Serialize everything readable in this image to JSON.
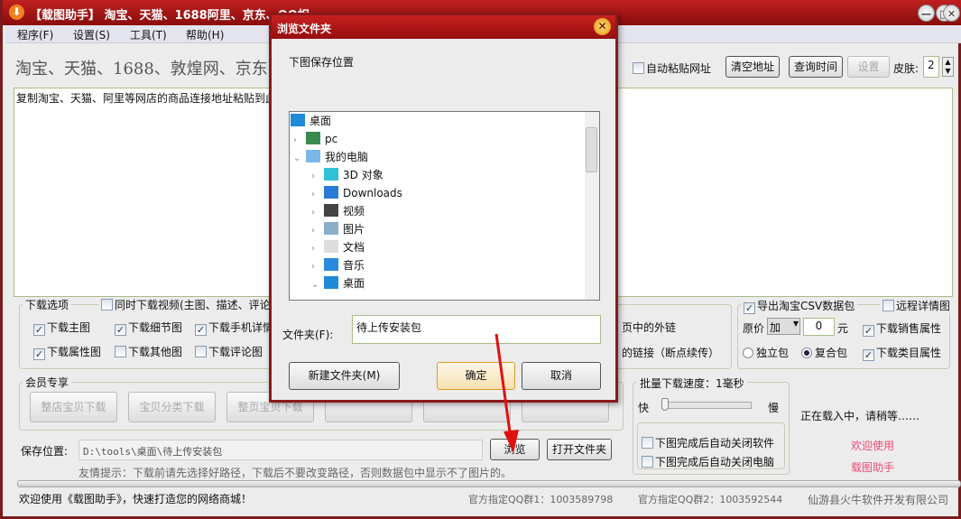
{
  "window": {
    "title": "【载图助手】 淘宝、天猫、1688阿里、京东、QQ相",
    "minimize": "—",
    "maximize": "□",
    "close": "✕"
  },
  "menu": [
    "程序(F)",
    "设置(S)",
    "工具(T)",
    "帮助(H)"
  ],
  "heading": "淘宝、天猫、1688、敦煌网、京东",
  "toolbar": {
    "auto_paste": "自动粘贴网址",
    "clear": "清空地址",
    "query_time": "查询时间",
    "settings": "设置",
    "skin_label": "皮肤:",
    "skin_value": "2"
  },
  "textarea": {
    "placeholder": "复制淘宝、天猫、阿里等网店的商品连接地址粘贴到此"
  },
  "options": {
    "title": "下载选项",
    "video": {
      "label": "同时下载视频(主图、描述、评论",
      "checked": false
    },
    "items": [
      {
        "label": "下载主图",
        "checked": true
      },
      {
        "label": "下载细节图",
        "checked": true
      },
      {
        "label": "下载手机详情",
        "checked": true
      },
      {
        "label": "下载属性图",
        "checked": true
      },
      {
        "label": "下载其他图",
        "checked": false
      },
      {
        "label": "下载评论图",
        "checked": false
      }
    ],
    "ext_link": "页中的外链",
    "resume_link": "的链接（断点续传）"
  },
  "csv": {
    "export": {
      "label": "导出淘宝CSV数据包",
      "checked": true
    },
    "remote": {
      "label": "远程详情图",
      "checked": false
    },
    "price_label": "原价",
    "price_op": "加",
    "price_value": "0",
    "price_unit": "元",
    "sales_attr": {
      "label": "下载销售属性",
      "checked": true
    },
    "category_attr": {
      "label": "下载类目属性",
      "checked": true
    },
    "standalone": "独立包",
    "composite": "复合包",
    "selected_package": "复合包"
  },
  "member": {
    "title": "会员专享",
    "buttons": [
      "整店宝贝下载",
      "宝贝分类下载",
      "整页宝贝下载",
      "",
      "",
      ""
    ]
  },
  "speed": {
    "title": "批量下载速度：1毫秒",
    "fast": "快",
    "slow": "慢",
    "level": 0,
    "close_app": {
      "label": "下图完成后自动关闭软件",
      "checked": false
    },
    "shutdown": {
      "label": "下图完成后自动关闭电脑",
      "checked": false
    }
  },
  "loading": "正在载入中，请稍等……",
  "welcome1": "欢迎使用",
  "welcome2": "载图助手",
  "save": {
    "label": "保存位置:",
    "path": "D:\\tools\\桌面\\待上传安装包",
    "browse": "浏览",
    "open": "打开文件夹",
    "hint": "友情提示：下载前请先选择好路径，下载后不要改变路径，否则数据包中显示不了图片的。"
  },
  "status": {
    "welcome": "欢迎使用《载图助手》，快速打造您的网络商城！",
    "qq1": "官方指定QQ群1：1003589798",
    "qq2": "官方指定QQ群2：1003592544",
    "company": "仙游县火牛软件开发有限公司"
  },
  "dialog": {
    "title": "浏览文件夹",
    "prompt": "下图保存位置",
    "folder_label": "文件夹(F):",
    "folder_value": "待上传安装包",
    "new_folder": "新建文件夹(M)",
    "ok": "确定",
    "cancel": "取消",
    "tree": [
      {
        "label": "桌面",
        "icon": "desktop-icon",
        "level": 0,
        "exp": ""
      },
      {
        "label": "pc",
        "icon": "user-icon",
        "level": 1,
        "exp": "›"
      },
      {
        "label": "我的电脑",
        "icon": "computer-icon",
        "level": 1,
        "exp": "⌄"
      },
      {
        "label": "3D 对象",
        "icon": "cube-icon",
        "level": 2,
        "exp": "›"
      },
      {
        "label": "Downloads",
        "icon": "download-icon",
        "level": 2,
        "exp": "›"
      },
      {
        "label": "视频",
        "icon": "video-icon",
        "level": 2,
        "exp": "›"
      },
      {
        "label": "图片",
        "icon": "picture-icon",
        "level": 2,
        "exp": "›"
      },
      {
        "label": "文档",
        "icon": "document-icon",
        "level": 2,
        "exp": "›"
      },
      {
        "label": "音乐",
        "icon": "music-icon",
        "level": 2,
        "exp": "›"
      },
      {
        "label": "桌面",
        "icon": "desktop-icon",
        "level": 2,
        "exp": "⌄"
      }
    ]
  }
}
